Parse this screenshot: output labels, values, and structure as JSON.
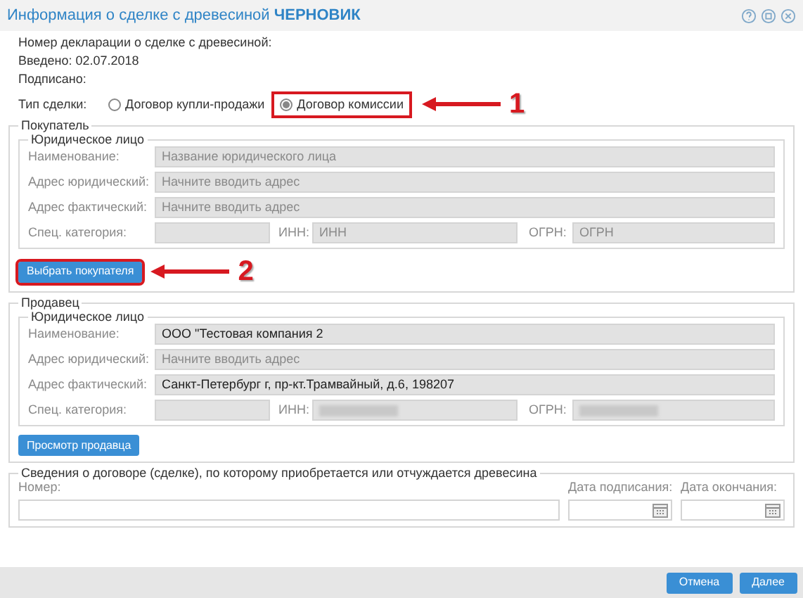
{
  "window": {
    "title": "Информация о сделке с древесиной",
    "status": "ЧЕРНОВИК"
  },
  "header_lines": [
    "Номер декларации о сделке с древесиной:",
    "Введено: 02.07.2018",
    "Подписано:"
  ],
  "deal_type": {
    "label": "Тип сделки:",
    "options": [
      {
        "label": "Договор купли-продажи",
        "selected": false,
        "highlighted": false
      },
      {
        "label": "Договор комиссии",
        "selected": true,
        "highlighted": true,
        "callout": "1"
      }
    ]
  },
  "parties": [
    {
      "legend": "Покупатель",
      "entity_legend": "Юридическое лицо",
      "fields": [
        {
          "label": "Наименование:",
          "placeholder": "Название юридического лица"
        },
        {
          "label": "Адрес юридический:",
          "placeholder": "Начните вводить адрес"
        },
        {
          "label": "Адрес фактический:",
          "placeholder": "Начните вводить адрес"
        }
      ],
      "category": {
        "label": "Спец. категория:"
      },
      "inn": {
        "label": "ИНН:",
        "placeholder": "ИНН"
      },
      "ogrn": {
        "label": "ОГРН:",
        "placeholder": "ОГРН"
      },
      "button": {
        "label": "Выбрать покупателя",
        "highlighted": true,
        "callout": "2"
      }
    },
    {
      "legend": "Продавец",
      "entity_legend": "Юридическое лицо",
      "fields": [
        {
          "label": "Наименование:",
          "value": "ООО \"Тестовая компания 2"
        },
        {
          "label": "Адрес юридический:",
          "placeholder": "Начните вводить адрес"
        },
        {
          "label": "Адрес фактический:",
          "value": "Санкт-Петербург г, пр-кт.Трамвайный, д.6, 198207"
        }
      ],
      "category": {
        "label": "Спец. категория:"
      },
      "inn": {
        "label": "ИНН:",
        "redacted": true
      },
      "ogrn": {
        "label": "ОГРН:",
        "redacted": true
      },
      "button": {
        "label": "Просмотр продавца",
        "highlighted": false
      }
    }
  ],
  "contract": {
    "legend": "Сведения о договоре (сделке), по которому приобретается или отчуждается древесина",
    "fields": [
      {
        "kind": "text",
        "label": "Номер:"
      },
      {
        "kind": "date",
        "label": "Дата подписания:"
      },
      {
        "kind": "date",
        "label": "Дата окончания:"
      }
    ]
  },
  "footer": {
    "buttons": [
      "Отмена",
      "Далее"
    ]
  }
}
